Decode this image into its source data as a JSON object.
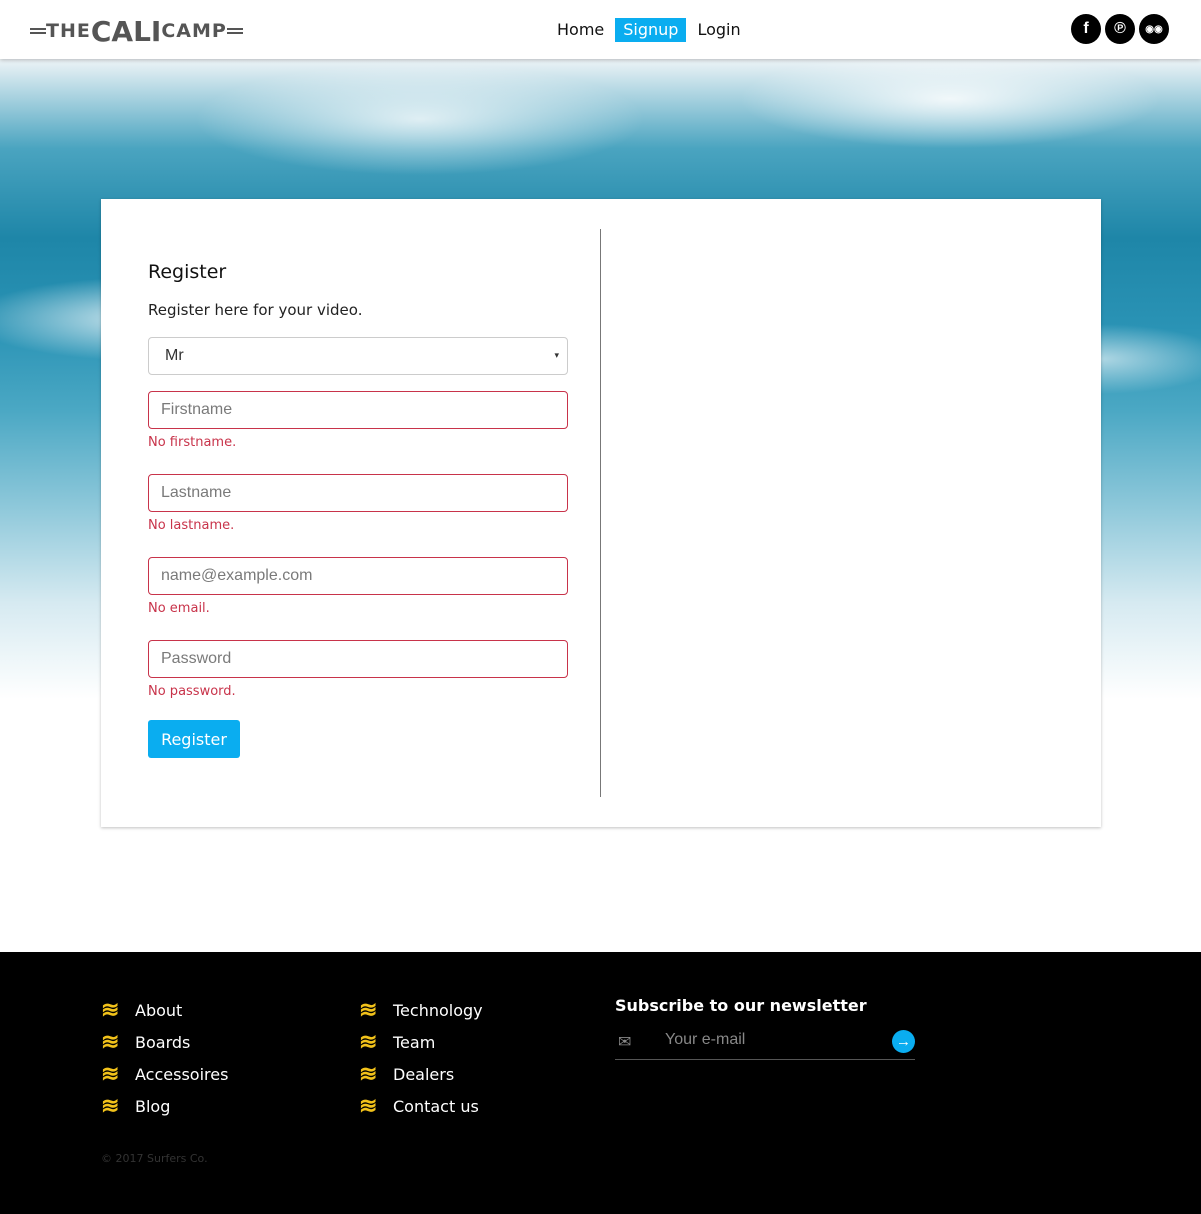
{
  "brand": {
    "the": "THE",
    "cali": "CALI",
    "camp": "CAMP"
  },
  "nav": [
    {
      "label": "Home",
      "active": false
    },
    {
      "label": "Signup",
      "active": true
    },
    {
      "label": "Login",
      "active": false
    }
  ],
  "social": [
    {
      "icon": "facebook-icon",
      "glyph": "f"
    },
    {
      "icon": "pinterest-icon",
      "glyph": "℗"
    },
    {
      "icon": "tripadvisor-icon",
      "glyph": "◉◉"
    }
  ],
  "form": {
    "title": "Register",
    "subtitle": "Register here for your video.",
    "salutation": {
      "value": "Mr",
      "arrow": "▾"
    },
    "firstname": {
      "placeholder": "Firstname",
      "error": "No firstname."
    },
    "lastname": {
      "placeholder": "Lastname",
      "error": "No lastname."
    },
    "email": {
      "placeholder": "name@example.com",
      "error": "No email."
    },
    "password": {
      "placeholder": "Password",
      "error": "No password."
    },
    "submit": "Register"
  },
  "footer": {
    "col1": [
      "About",
      "Boards",
      "Accessoires",
      "Blog"
    ],
    "col2": [
      "Technology",
      "Team",
      "Dealers",
      "Contact us"
    ],
    "newsletter": {
      "title": "Subscribe to our newsletter",
      "placeholder": "Your e-mail"
    },
    "copyright": "© 2017 Surfers Co."
  },
  "colors": {
    "accent": "#0aadf0",
    "error": "#c8334a",
    "wave": "#f2c21a"
  }
}
